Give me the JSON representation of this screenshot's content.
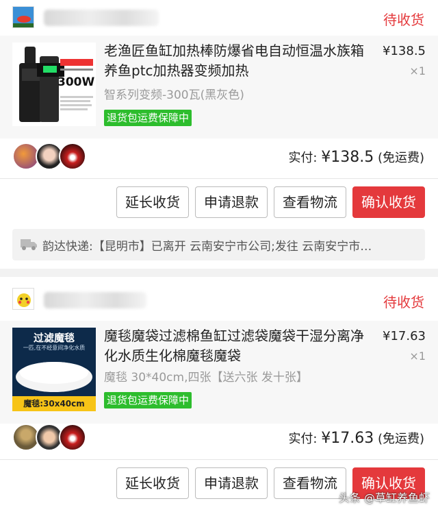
{
  "orders": [
    {
      "status": "待收货",
      "title": "老渔匠鱼缸加热棒防爆省电自动恒温水族箱养鱼ptc加热器变频加热",
      "spec": "智系列变频-300瓦(黑灰色)",
      "guarantee": "退货包运费保障中",
      "price": "¥138.5",
      "qty": "×1",
      "thumb_text": "300W",
      "paid_label": "实付: ",
      "paid_amount": "¥138.5",
      "shipping_note": " (免运费)",
      "buttons": [
        "延长收货",
        "申请退款",
        "查看物流",
        "确认收货"
      ],
      "logistics": "韵达快递:【昆明市】已离开 云南安宁市公司;发往 云南安宁市…"
    },
    {
      "status": "待收货",
      "title": "魔毯魔袋过滤棉鱼缸过滤袋魔袋干湿分离净化水质生化棉魔毯魔袋",
      "spec": "魔毯 30*40cm,四张【送六张 发十张】",
      "guarantee": "退货包运费保障中",
      "price": "¥17.63",
      "qty": "×1",
      "thumb_title": "过滤魔毯",
      "thumb_sub": "一匹,在不经意间净化水质",
      "thumb_label": "魔毯:30x40cm",
      "paid_label": "实付: ",
      "paid_amount": "¥17.63",
      "shipping_note": " (免运费)",
      "buttons": [
        "延长收货",
        "申请退款",
        "查看物流",
        "确认收货"
      ]
    }
  ],
  "watermark": "头条 @草缸养鱼虾",
  "colors": {
    "accent": "#e4393c",
    "guarantee": "#2dbd2d"
  }
}
